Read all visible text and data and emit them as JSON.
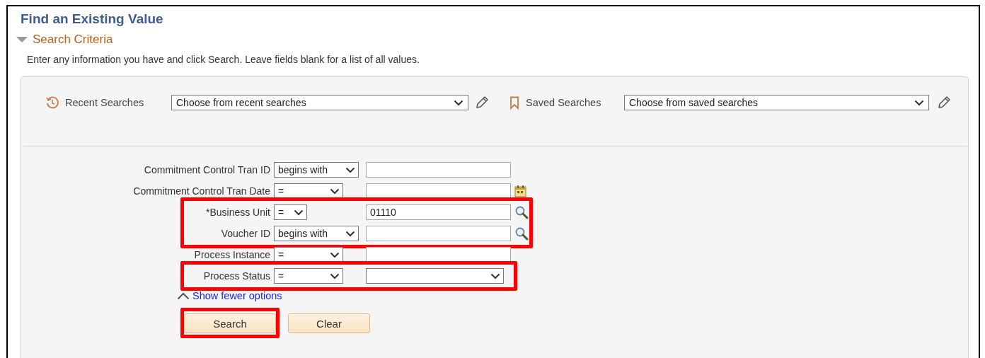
{
  "page_title": "Find an Existing Value",
  "section": {
    "title": "Search Criteria",
    "expanded": true
  },
  "instructions": "Enter any information you have and click Search. Leave fields blank for a list of all values.",
  "recent_searches": {
    "label": "Recent Searches",
    "value": "Choose from recent searches"
  },
  "saved_searches": {
    "label": "Saved Searches",
    "value": "Choose from saved searches"
  },
  "field_groups": [
    {
      "highlighted": false,
      "rows": [
        {
          "kind": "text",
          "label": "Commitment Control Tran ID",
          "operator": "begins with"
        },
        {
          "kind": "date",
          "label": "Commitment Control Tran Date",
          "operator": "="
        }
      ]
    },
    {
      "highlighted": true,
      "rows": [
        {
          "kind": "key",
          "label": "*Business Unit",
          "operator": "=",
          "value": "01110"
        },
        {
          "kind": "prompt",
          "label": "Voucher ID",
          "operator": "begins with"
        }
      ]
    },
    {
      "highlighted": false,
      "rows": [
        {
          "kind": "number",
          "label": "Process Instance",
          "operator": "="
        }
      ]
    },
    {
      "highlighted": true,
      "rows": [
        {
          "kind": "dropdown",
          "label": "Process Status",
          "operator": "="
        }
      ]
    }
  ],
  "options_link": "Show fewer options",
  "buttons": [
    {
      "label": "Search",
      "highlighted": true
    },
    {
      "label": "Clear",
      "highlighted": false
    }
  ]
}
